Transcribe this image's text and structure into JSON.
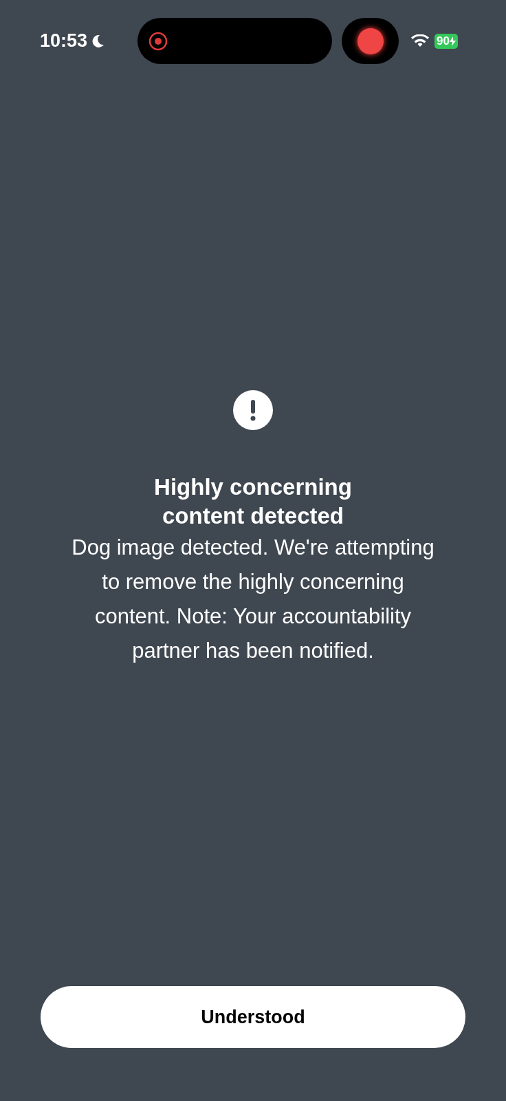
{
  "status_bar": {
    "time": "10:53",
    "battery": "90"
  },
  "alert": {
    "title": "Highly concerning content detected",
    "message": "Dog image detected. We're attempting to remove the highly concerning content. Note: Your accountability partner has been notified."
  },
  "button": {
    "label": "Understood"
  }
}
